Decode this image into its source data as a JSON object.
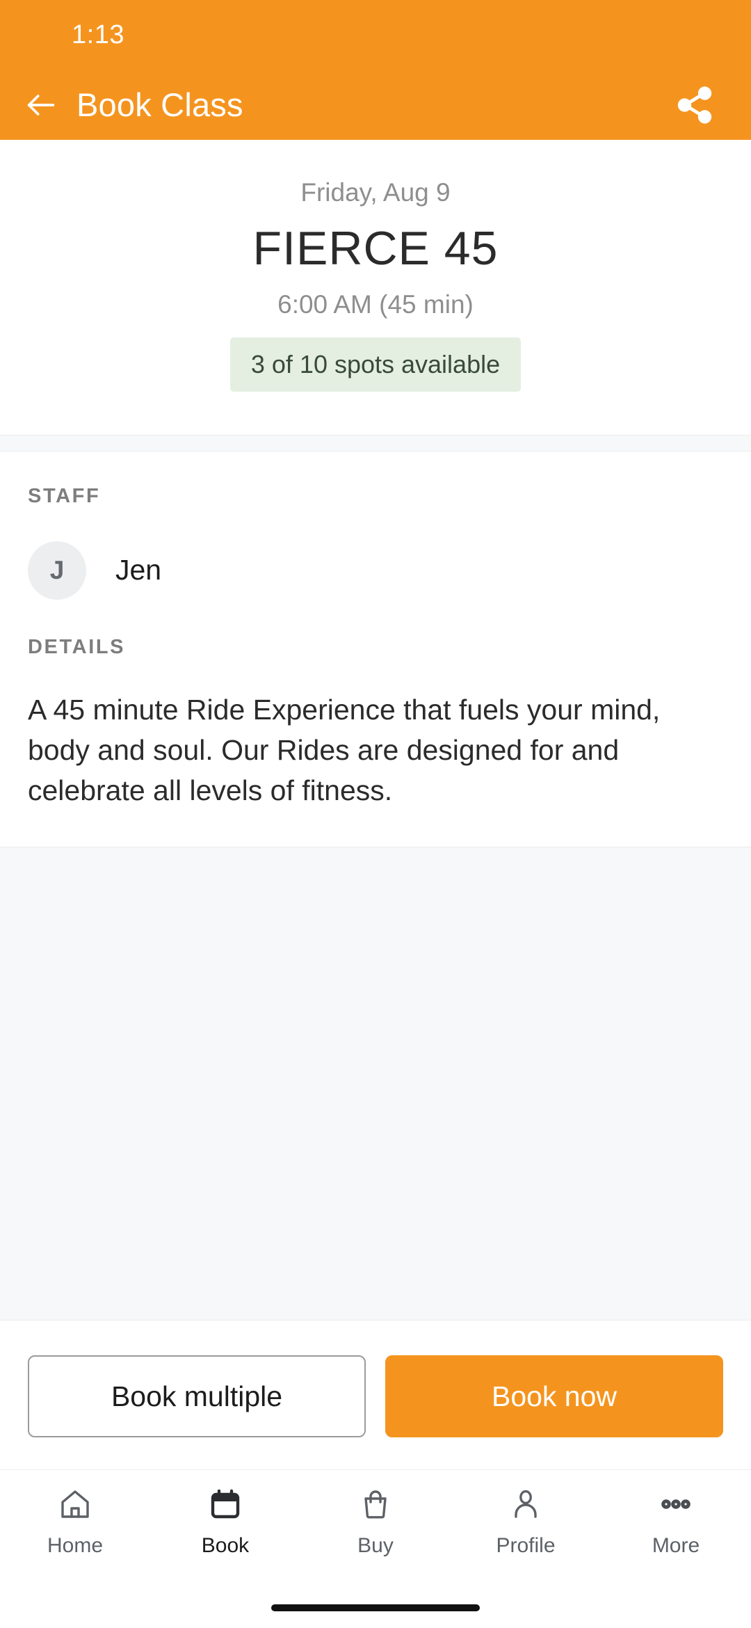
{
  "status_bar": {
    "time": "1:13"
  },
  "app_bar": {
    "title": "Book Class",
    "back_icon": "arrow-left-icon",
    "share_icon": "share-icon"
  },
  "class": {
    "date": "Friday, Aug 9",
    "name": "FIERCE 45",
    "time": "6:00 AM (45 min)",
    "availability": "3 of 10 spots available"
  },
  "staff": {
    "label": "STAFF",
    "avatar_initial": "J",
    "name": "Jen"
  },
  "details": {
    "label": "DETAILS",
    "body": "A 45 minute Ride Experience that fuels your mind, body and soul. Our Rides are designed for and celebrate all levels of fitness."
  },
  "actions": {
    "secondary_label": "Book multiple",
    "primary_label": "Book now"
  },
  "bottom_nav": {
    "items": [
      {
        "label": "Home",
        "icon": "home-icon"
      },
      {
        "label": "Book",
        "icon": "calendar-icon"
      },
      {
        "label": "Buy",
        "icon": "shopping-bag-icon"
      },
      {
        "label": "Profile",
        "icon": "person-icon"
      },
      {
        "label": "More",
        "icon": "ellipsis-icon"
      }
    ],
    "active_index": 1
  },
  "colors": {
    "brand_orange": "#f4941f",
    "badge_green_bg": "#e4efe2",
    "badge_green_text": "#394b38",
    "band_gray": "#f7f8fa",
    "avatar_gray": "#eceef0"
  }
}
